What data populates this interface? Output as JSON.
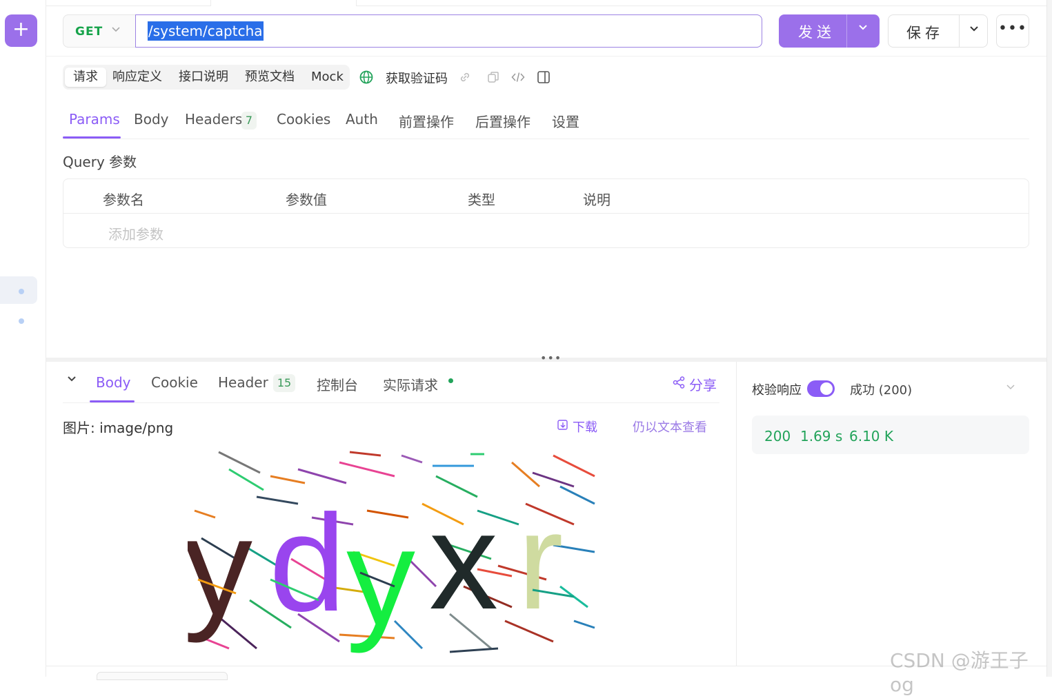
{
  "rail": {
    "new_icon": "plus-icon"
  },
  "request": {
    "method": "GET",
    "url": "/system/captcha",
    "send_label": "发送",
    "save_label": "保存",
    "more_icon": "ellipsis-icon"
  },
  "sub_tabs": [
    "请求",
    "响应定义",
    "接口说明",
    "预览文档",
    "Mock"
  ],
  "api_name": "获取验证码",
  "param_tabs": {
    "params": "Params",
    "body": "Body",
    "headers": "Headers",
    "headers_count": "7",
    "cookies": "Cookies",
    "auth": "Auth",
    "pre": "前置操作",
    "post": "后置操作",
    "settings": "设置"
  },
  "query": {
    "title": "Query 参数",
    "columns": [
      "参数名",
      "参数值",
      "类型",
      "说明"
    ],
    "add_placeholder": "添加参数"
  },
  "response": {
    "tabs": {
      "body": "Body",
      "cookie": "Cookie",
      "header": "Header",
      "header_count": "15",
      "console": "控制台",
      "actual": "实际请求"
    },
    "share": "分享",
    "image_label": "图片: image/png",
    "download": "下载",
    "view_as_text": "仍以文本查看",
    "captcha_text": "ydyxr",
    "verify_label": "校验响应",
    "verify_on": true,
    "status_text": "成功 (200)",
    "status_code": "200",
    "time": "1.69 s",
    "size": "6.10 K"
  },
  "colors": {
    "accent": "#8b5cf6",
    "method": "#16a34a",
    "success": "#22a35a"
  },
  "watermark": "CSDN @游王子og"
}
